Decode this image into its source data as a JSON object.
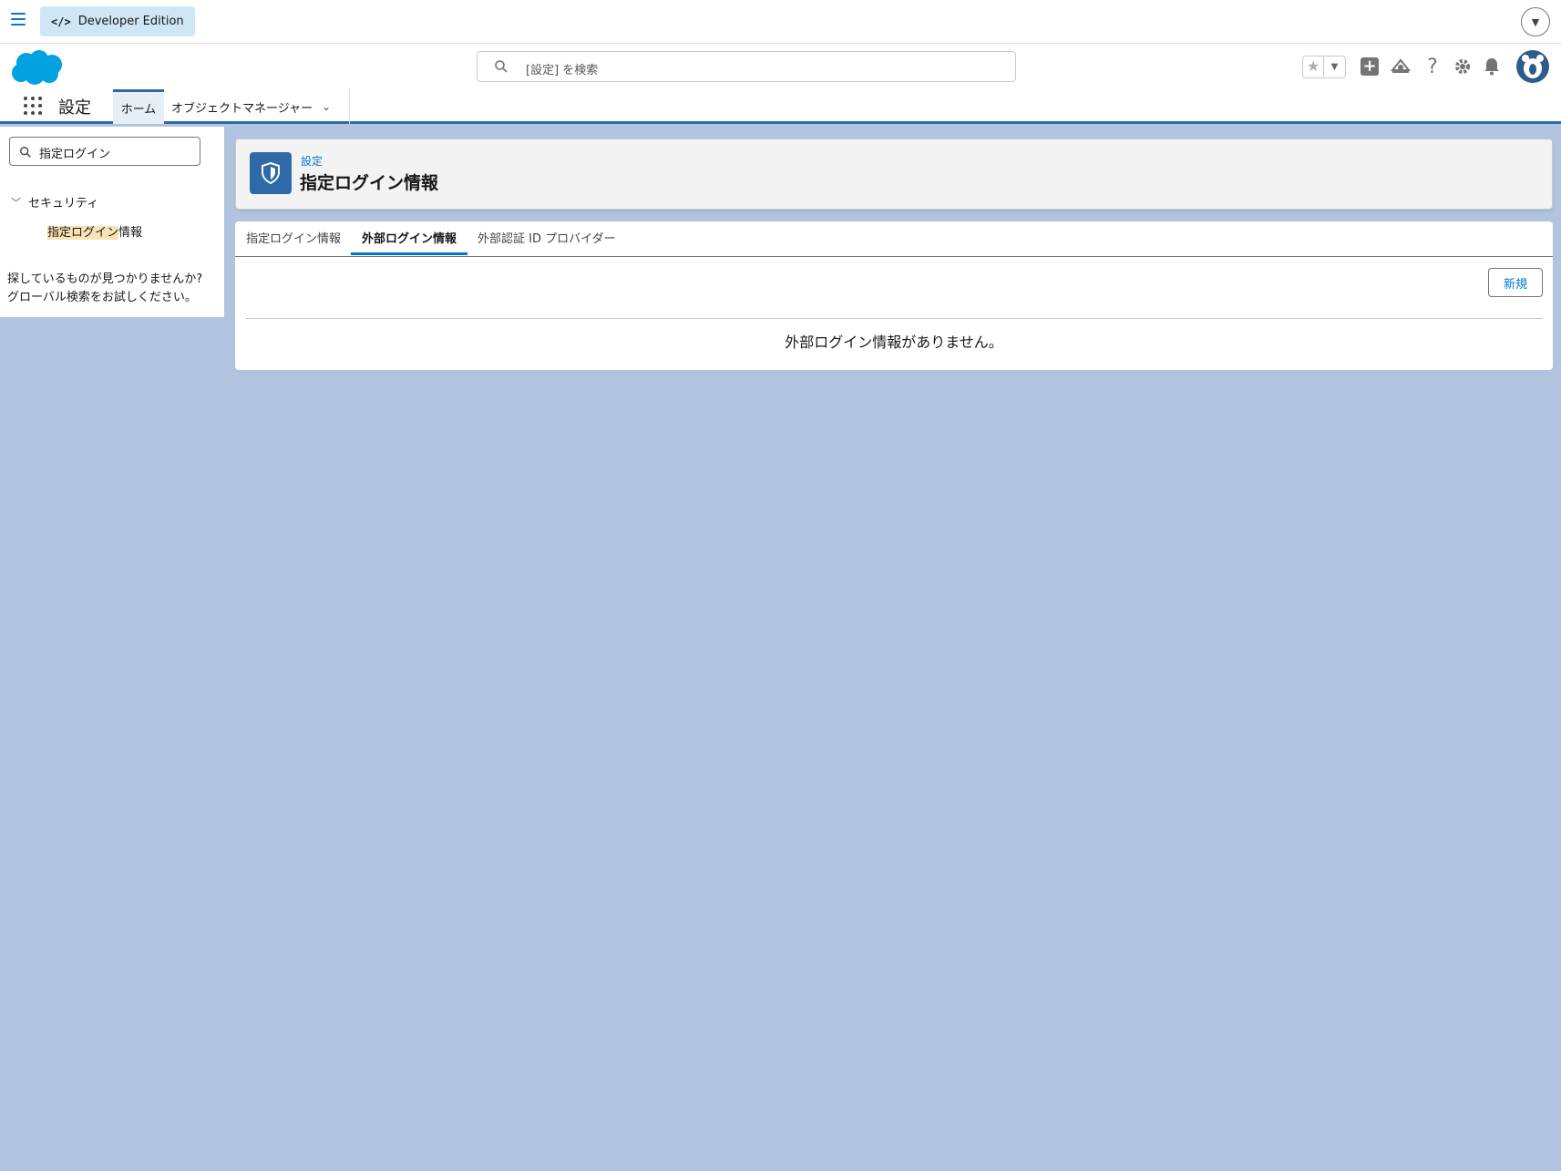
{
  "devbar": {
    "edition_label": "Developer Edition"
  },
  "header": {
    "search_placeholder": "[設定] を検索"
  },
  "nav": {
    "app_name": "設定",
    "home_tab": "ホーム",
    "object_manager_tab": "オブジェクトマネージャー"
  },
  "sidebar": {
    "quickfind_value": "指定ログイン",
    "section_label": "セキュリティ",
    "item_highlight": "指定ログイン",
    "item_rest": "情報",
    "help_line1": "探しているものが見つかりませんか?",
    "help_line2": "グローバル検索をお試しください。"
  },
  "page": {
    "breadcrumb": "設定",
    "title": "指定ログイン情報",
    "tabs": [
      "指定ログイン情報",
      "外部ログイン情報",
      "外部認証 ID プロバイダー"
    ],
    "active_tab_index": 1,
    "new_button": "新規",
    "empty_message": "外部ログイン情報がありません。"
  },
  "colors": {
    "brand": "#0176d3",
    "page_bg": "#b0c4df",
    "icon_bg": "#2f6aa8",
    "highlight": "#f9e3b6"
  },
  "icons": [
    "hamburger-icon",
    "code-icon",
    "salesforce-logo",
    "search-icon",
    "star-icon",
    "plus-icon",
    "trailhead-icon",
    "help-icon",
    "gear-icon",
    "bell-icon",
    "avatar",
    "app-launcher-icon",
    "chevron-down-icon",
    "shield-icon"
  ]
}
